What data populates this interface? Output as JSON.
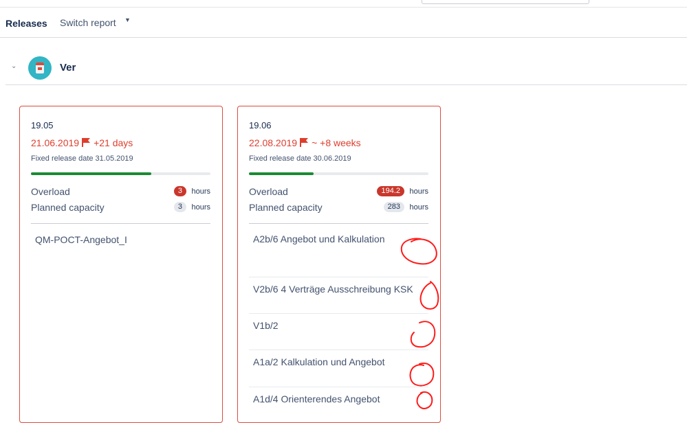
{
  "subnav": {
    "title": "Releases",
    "switch_label": "Switch report"
  },
  "project": {
    "name": "Ver"
  },
  "releases": [
    {
      "version": "19.05",
      "due_date": "21.06.2019",
      "delta": "+21 days",
      "fixed_label": "Fixed release date 31.05.2019",
      "progress": 0.67,
      "overload_label": "Overload",
      "overload_value": "3",
      "capacity_label": "Planned capacity",
      "capacity_value": "3",
      "unit": "hours",
      "issues": [
        "QM-POCT-Angebot_I"
      ]
    },
    {
      "version": "19.06",
      "due_date": "22.08.2019",
      "delta": "~ +8 weeks",
      "fixed_label": "Fixed release date 30.06.2019",
      "progress": 0.36,
      "overload_label": "Overload",
      "overload_value": "194.2",
      "capacity_label": "Planned capacity",
      "capacity_value": "283",
      "unit": "hours",
      "issues": [
        "A2b/6 Angebot und Kalkulation",
        "V2b/6 4 Verträge Ausschreibung KSK",
        "V1b/2",
        "A1a/2 Kalkulation und Angebot",
        "A1d/4 Orienterendes Angebot"
      ]
    }
  ],
  "colors": {
    "accent_red": "#de3e2d",
    "progress_green": "#1b8a34",
    "annotation_red": "#ff1a1a"
  }
}
